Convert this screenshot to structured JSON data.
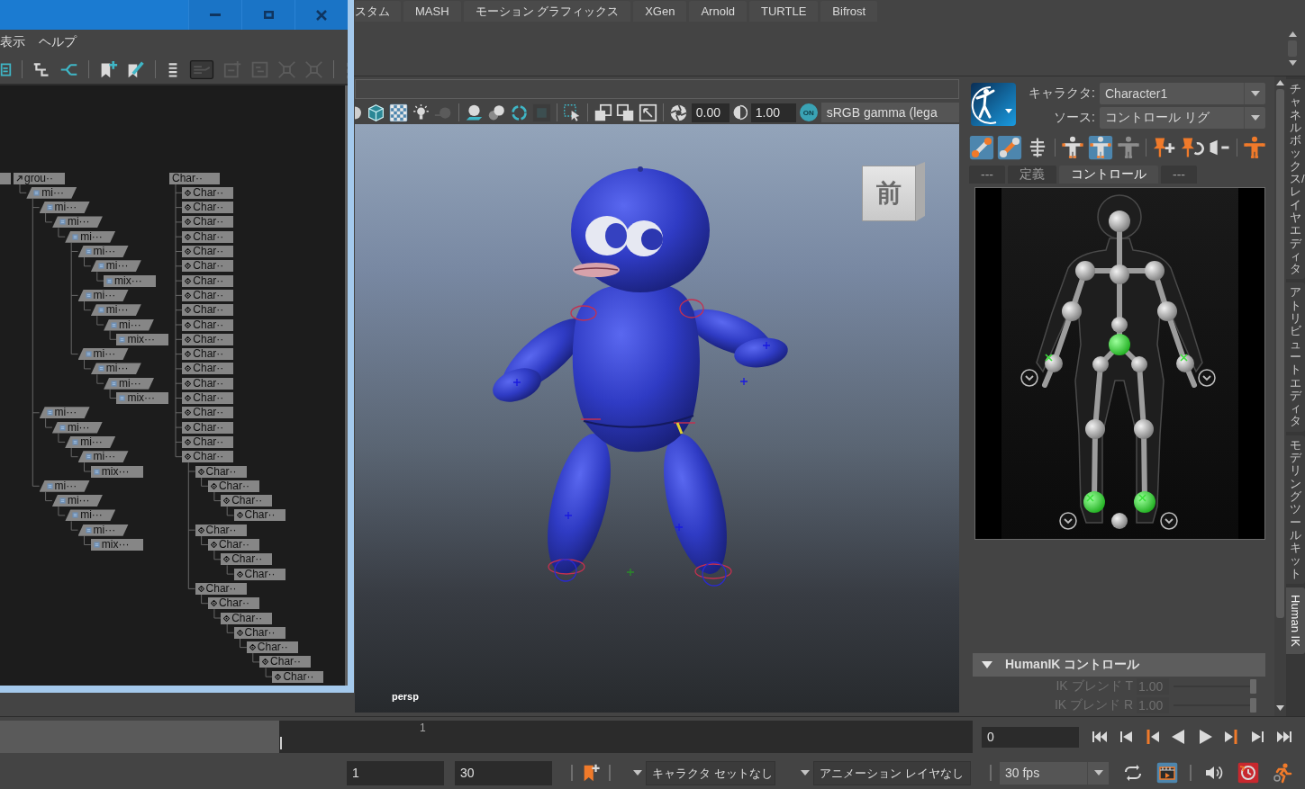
{
  "hypergraph_window": {
    "menu": [
      "表示",
      "ヘルプ"
    ],
    "toolbar": [
      {
        "on": false,
        "disabled": false
      },
      {
        "on": false,
        "disabled": false
      },
      {
        "on": false,
        "disabled": false
      },
      {
        "on": false,
        "disabled": false
      },
      {
        "on": false,
        "disabled": false
      },
      {
        "on": false,
        "disabled": false
      },
      {
        "on": true,
        "disabled": true
      },
      {
        "on": false,
        "disabled": true
      },
      {
        "on": false,
        "disabled": true
      },
      {
        "on": false,
        "disabled": true
      },
      {
        "on": false,
        "disabled": true
      },
      {
        "on": false,
        "disabled": true
      }
    ],
    "trees": [
      {
        "label": "grou··",
        "kind": "group",
        "children": [
          {
            "label": "mi···",
            "kind": "slanted",
            "children": [
              {
                "label": "mi···",
                "kind": "slanted",
                "children": [
                  {
                    "label": "mi···",
                    "kind": "slanted",
                    "children": [
                      {
                        "label": "mi···",
                        "kind": "slanted",
                        "children": [
                          {
                            "label": "mi···",
                            "kind": "slanted",
                            "children": [
                              {
                                "label": "mi···",
                                "kind": "slanted",
                                "children": [
                                  {
                                    "label": "mix···",
                                    "kind": "box"
                                  }
                                ]
                              }
                            ]
                          },
                          {
                            "label": "mi···",
                            "kind": "slanted",
                            "children": [
                              {
                                "label": "mi···",
                                "kind": "slanted",
                                "children": [
                                  {
                                    "label": "mi···",
                                    "kind": "slanted",
                                    "children": [
                                      {
                                        "label": "mix···",
                                        "kind": "box"
                                      }
                                    ]
                                  }
                                ]
                              }
                            ]
                          },
                          {
                            "label": "mi···",
                            "kind": "slanted",
                            "children": [
                              {
                                "label": "mi···",
                                "kind": "slanted",
                                "children": [
                                  {
                                    "label": "mi···",
                                    "kind": "slanted",
                                    "children": [
                                      {
                                        "label": "mix···",
                                        "kind": "box"
                                      }
                                    ]
                                  }
                                ]
                              }
                            ]
                          }
                        ]
                      }
                    ]
                  }
                ]
              },
              {
                "label": "mi···",
                "kind": "slanted",
                "children": [
                  {
                    "label": "mi···",
                    "kind": "slanted",
                    "children": [
                      {
                        "label": "mi···",
                        "kind": "slanted",
                        "children": [
                          {
                            "label": "mi···",
                            "kind": "slanted",
                            "children": [
                              {
                                "label": "mix···",
                                "kind": "box"
                              }
                            ]
                          }
                        ]
                      }
                    ]
                  }
                ]
              },
              {
                "label": "mi···",
                "kind": "slanted",
                "children": [
                  {
                    "label": "mi···",
                    "kind": "slanted",
                    "children": [
                      {
                        "label": "mi···",
                        "kind": "slanted",
                        "children": [
                          {
                            "label": "mi···",
                            "kind": "slanted",
                            "children": [
                              {
                                "label": "mix···",
                                "kind": "box"
                              }
                            ]
                          }
                        ]
                      }
                    ]
                  }
                ]
              }
            ]
          }
        ]
      },
      {
        "label": "Char··",
        "kind": "plain",
        "children": [
          {
            "label": "Char··",
            "kind": "joint"
          },
          {
            "label": "Char··",
            "kind": "joint"
          },
          {
            "label": "Char··",
            "kind": "joint"
          },
          {
            "label": "Char··",
            "kind": "joint"
          },
          {
            "label": "Char··",
            "kind": "joint"
          },
          {
            "label": "Char··",
            "kind": "joint"
          },
          {
            "label": "Char··",
            "kind": "joint"
          },
          {
            "label": "Char··",
            "kind": "joint"
          },
          {
            "label": "Char··",
            "kind": "joint"
          },
          {
            "label": "Char··",
            "kind": "joint"
          },
          {
            "label": "Char··",
            "kind": "joint"
          },
          {
            "label": "Char··",
            "kind": "joint"
          },
          {
            "label": "Char··",
            "kind": "joint"
          },
          {
            "label": "Char··",
            "kind": "joint"
          },
          {
            "label": "Char··",
            "kind": "joint"
          },
          {
            "label": "Char··",
            "kind": "joint"
          },
          {
            "label": "Char··",
            "kind": "joint"
          },
          {
            "label": "Char··",
            "kind": "joint"
          },
          {
            "label": "Char··",
            "kind": "joint",
            "children": [
              {
                "label": "Char··",
                "kind": "joint",
                "children": [
                  {
                    "label": "Char··",
                    "kind": "joint",
                    "children": [
                      {
                        "label": "Char··",
                        "kind": "joint",
                        "children": [
                          {
                            "label": "Char··",
                            "kind": "joint"
                          }
                        ]
                      }
                    ]
                  }
                ]
              },
              {
                "label": "Char··",
                "kind": "joint",
                "children": [
                  {
                    "label": "Char··",
                    "kind": "joint",
                    "children": [
                      {
                        "label": "Char··",
                        "kind": "joint",
                        "children": [
                          {
                            "label": "Char··",
                            "kind": "joint"
                          }
                        ]
                      }
                    ]
                  }
                ]
              },
              {
                "label": "Char··",
                "kind": "joint",
                "children": [
                  {
                    "label": "Char··",
                    "kind": "joint",
                    "children": [
                      {
                        "label": "Char··",
                        "kind": "joint",
                        "children": [
                          {
                            "label": "Char··",
                            "kind": "joint",
                            "children": [
                              {
                                "label": "Char··",
                                "kind": "joint",
                                "children": [
                                  {
                                    "label": "Char··",
                                    "kind": "joint",
                                    "children": [
                                      {
                                        "label": "Char··",
                                        "kind": "joint"
                                      }
                                    ]
                                  }
                                ]
                              }
                            ]
                          }
                        ]
                      }
                    ]
                  }
                ]
              }
            ]
          }
        ]
      }
    ]
  },
  "shelf_tabs": [
    "スタム",
    "MASH",
    "モーション グラフィックス",
    "XGen",
    "Arnold",
    "TURTLE",
    "Bifrost"
  ],
  "viewport": {
    "toolbar": [
      {
        "on": false,
        "disabled": false
      },
      {
        "on": false,
        "disabled": false
      },
      {
        "on": true,
        "disabled": false
      },
      {
        "on": false,
        "disabled": false
      },
      {
        "on": false,
        "disabled": true
      },
      {
        "on": false,
        "disabled": false
      },
      {
        "on": false,
        "disabled": false
      },
      {
        "on": false,
        "disabled": false
      },
      {
        "on": false,
        "disabled": true
      },
      {
        "on": false,
        "disabled": false
      },
      {
        "on": false,
        "disabled": false
      },
      {
        "on": false,
        "disabled": false
      },
      {
        "on": false,
        "disabled": false
      },
      {
        "on": false,
        "disabled": false
      }
    ],
    "exposure": "0.00",
    "gamma": "1.00",
    "color_management": "ON",
    "view_transform": "sRGB gamma (lega",
    "view_cube": "前",
    "camera": "persp"
  },
  "humanik": {
    "character_label": "キャラクタ:",
    "character": "Character1",
    "source_label": "ソース:",
    "source": "コントロール リグ",
    "tools": [
      {
        "on": true
      },
      {
        "on": true
      },
      {
        "on": false
      },
      {
        "on": false
      },
      {
        "on": true
      },
      {
        "on": false
      },
      {
        "on": false
      },
      {
        "on": false
      },
      {
        "on": false
      },
      {
        "on": false
      }
    ],
    "tabs": [
      {
        "label": "---",
        "selected": false
      },
      {
        "label": "定義",
        "selected": false
      },
      {
        "label": "コントロール",
        "selected": true
      },
      {
        "label": "---",
        "selected": false
      }
    ],
    "section": {
      "title": "HumanIK コントロール",
      "expanded": true,
      "rows": [
        {
          "label": "IK ブレンド T",
          "value": "1.00",
          "level": 1,
          "disabled": true
        },
        {
          "label": "IK ブレンド R",
          "value": "1.00",
          "level": 1,
          "disabled": true
        }
      ]
    }
  },
  "side_tabs": [
    {
      "label": "チャネルボックス/レイヤエディタ",
      "selected": false
    },
    {
      "label": "アトリビュートエディタ",
      "selected": false
    },
    {
      "label": "モデリングツールキット",
      "selected": false
    },
    {
      "label": "Human IK",
      "selected": true
    }
  ],
  "timeline": {
    "frame_label": "1",
    "level": 0,
    "current_frame": "0"
  },
  "range_bar": {
    "start": "1",
    "end": "30",
    "character_set": "キャラクタ セットなし",
    "anim_layer": "アニメーション レイヤなし",
    "fps": "30 fps",
    "toggles": [
      {
        "on": false
      },
      {
        "on": true
      },
      {
        "on": false
      },
      {
        "on": true
      },
      {
        "on": false
      }
    ]
  }
}
